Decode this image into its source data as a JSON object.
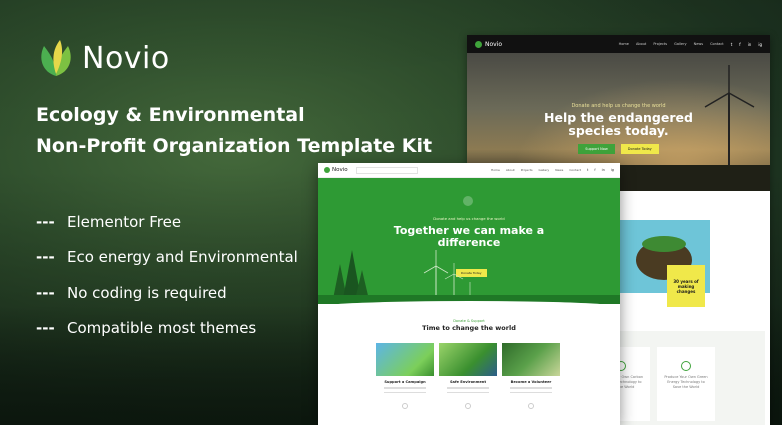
{
  "brand": {
    "name": "Novio",
    "accent_green": "#3fa33b",
    "accent_yellow": "#f0e84a"
  },
  "headline": {
    "line1": "Ecology & Environmental",
    "line2": "Non-Profit Organization Template Kit"
  },
  "features": [
    {
      "dash": "---",
      "label": "Elementor Free"
    },
    {
      "dash": "---",
      "label": "Eco energy and Environmental"
    },
    {
      "dash": "---",
      "label": "No coding is required"
    },
    {
      "dash": "---",
      "label": "Compatible most themes"
    }
  ],
  "back_mockup": {
    "brand": "Novio",
    "menu": [
      "Home",
      "About",
      "Projects",
      "Gallery",
      "News",
      "Contact"
    ],
    "social": [
      "t",
      "f",
      "in",
      "ig"
    ],
    "hero_small": "Donate and help us change the world",
    "hero_title_1": "Help the endangered",
    "hero_title_2": "species today.",
    "btn_primary": "Support Now",
    "btn_secondary": "Donate Today",
    "badge_text": "30 years of making changes",
    "cards": [
      {
        "text": "Reduce Your Own Carbon Footprint Technology to Save the World"
      },
      {
        "text": "Produce Your Own Green Energy Technology to Save the World"
      }
    ]
  },
  "front_mockup": {
    "brand": "Novio",
    "menu": [
      "Home",
      "About",
      "Projects",
      "Gallery",
      "News",
      "Contact"
    ],
    "social": [
      "t",
      "f",
      "in",
      "ig"
    ],
    "hero_small": "Donate and help us change the world",
    "hero_title_1": "Together we can make a",
    "hero_title_2": "difference",
    "hero_btn": "Donate Today",
    "section_small": "Donate & Support",
    "section_title": "Time to change the world",
    "cards": [
      {
        "label": "Support a Campaign"
      },
      {
        "label": "Safe Environment"
      },
      {
        "label": "Become a Volunteer"
      }
    ]
  }
}
